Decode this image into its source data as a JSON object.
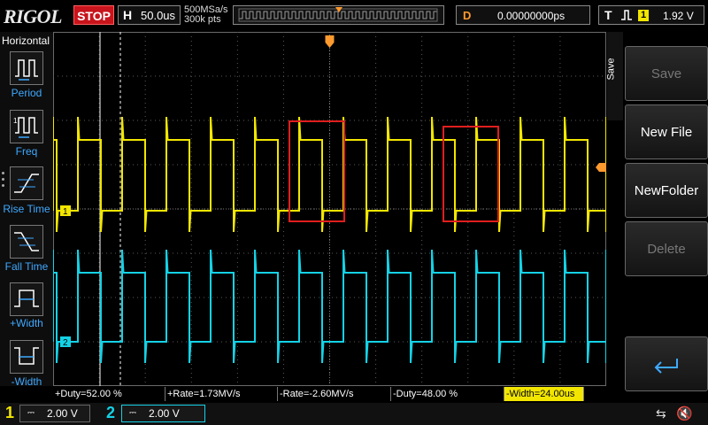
{
  "header": {
    "logo": "RIGOL",
    "run_state": "STOP",
    "horizontal_label": "H",
    "timebase": "50.0us",
    "sample_rate": "500MSa/s",
    "memory_depth": "300k pts",
    "delay_label": "D",
    "delay_value": "0.00000000ps",
    "trigger_label": "T",
    "trigger_source": "1",
    "trigger_level": "1.92 V"
  },
  "left_menu": {
    "title": "Horizontal",
    "items": [
      {
        "label": "Period",
        "icon": "period-icon"
      },
      {
        "label": "Freq",
        "icon": "frequency-icon"
      },
      {
        "label": "Rise Time",
        "icon": "rise-time-icon"
      },
      {
        "label": "Fall Time",
        "icon": "fall-time-icon"
      },
      {
        "label": "+Width",
        "icon": "positive-width-icon"
      },
      {
        "label": "-Width",
        "icon": "negative-width-icon"
      }
    ]
  },
  "right_menu": {
    "tab": "Save",
    "items": [
      {
        "label": "Save",
        "enabled": false
      },
      {
        "label": "New File",
        "enabled": true
      },
      {
        "label": "NewFolder",
        "enabled": true
      },
      {
        "label": "Delete",
        "enabled": false
      },
      {
        "label": "",
        "icon": "return-icon",
        "enabled": true
      }
    ]
  },
  "channels": [
    {
      "number": "1",
      "scale": "2.00 V",
      "color": "#f2e600",
      "marker": "1"
    },
    {
      "number": "2",
      "scale": "2.00 V",
      "color": "#14d2e6",
      "marker": "2"
    }
  ],
  "measurements": [
    {
      "text": "+Duty=52.00 %",
      "highlight": false
    },
    {
      "text": "+Rate=1.73MV/s",
      "highlight": false
    },
    {
      "text": "-Rate=-2.60MV/s",
      "highlight": false
    },
    {
      "text": "-Duty=48.00 %",
      "highlight": false
    },
    {
      "text": "-Width=24.00us",
      "highlight": true
    }
  ],
  "colors": {
    "ch1": "#f2e600",
    "ch2": "#14d2e6",
    "trigger": "#ff9a2e",
    "annotation": "#e01e1e",
    "grid": "#5a5a5a"
  },
  "waveform": {
    "period_divisions": 0.96,
    "duty_percent": 52.0,
    "visible_periods": 10
  }
}
